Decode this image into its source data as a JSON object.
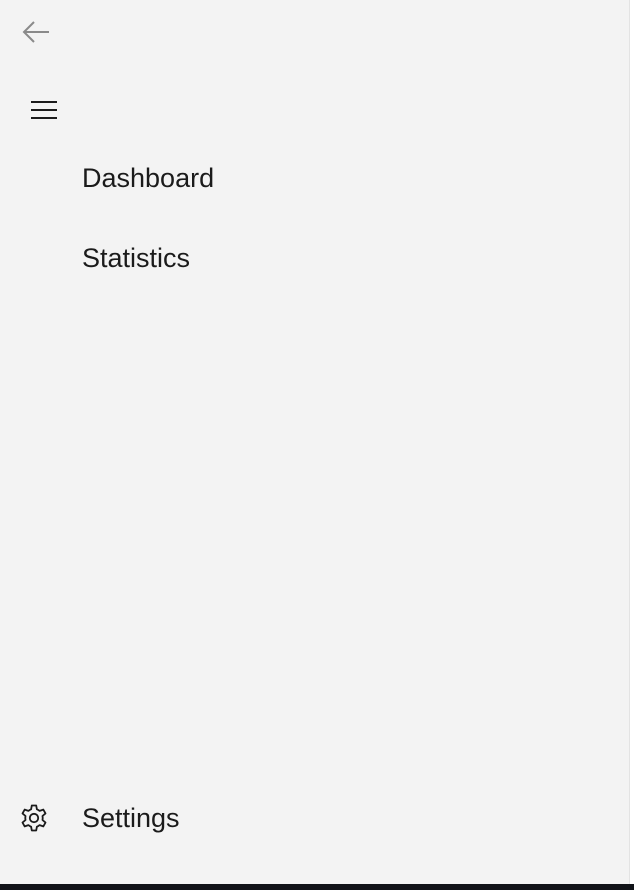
{
  "navigation": {
    "back": {
      "icon": "arrow-left-icon"
    },
    "menu": {
      "icon": "hamburger-menu-icon"
    },
    "items": [
      {
        "label": "Dashboard"
      },
      {
        "label": "Statistics"
      }
    ],
    "footer": {
      "settings": {
        "label": "Settings",
        "icon": "gear-icon"
      }
    }
  },
  "colors": {
    "pane_background": "#f3f3f3",
    "text": "#1b1b1b",
    "icon_muted": "#8a8a8a",
    "taskbar": "#111318"
  }
}
